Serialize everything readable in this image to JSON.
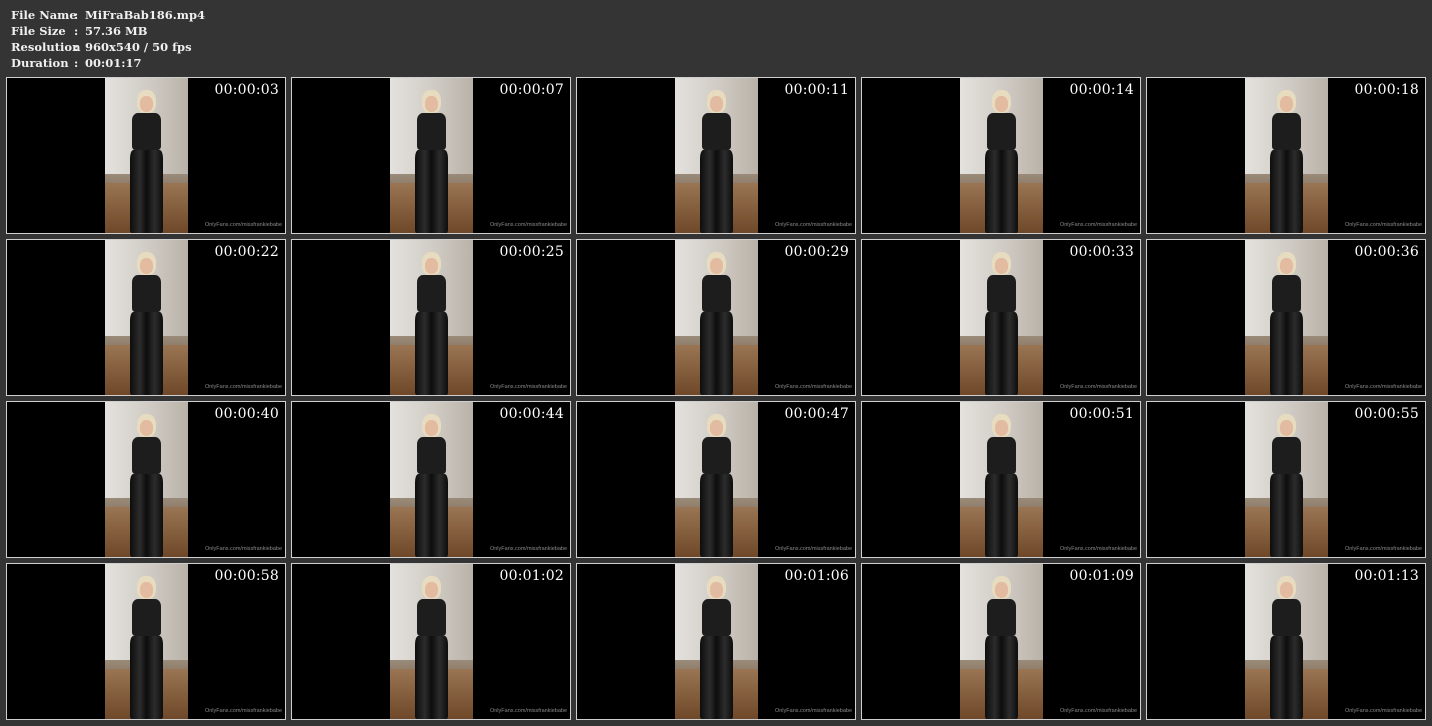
{
  "info": {
    "rows": [
      {
        "key": "File Name",
        "sep": ":",
        "value": "MiFraBab186.mp4"
      },
      {
        "key": "File Size",
        "sep": ":",
        "value": "57.36 MB"
      },
      {
        "key": "Resolution",
        "sep": ":",
        "value": "960x540 / 50 fps"
      },
      {
        "key": "Duration",
        "sep": ":",
        "value": "00:01:17"
      }
    ]
  },
  "watermark": "OnlyFans.com/missfrankiebabe",
  "thumbnails": [
    {
      "timestamp": "00:00:03"
    },
    {
      "timestamp": "00:00:07"
    },
    {
      "timestamp": "00:00:11"
    },
    {
      "timestamp": "00:00:14"
    },
    {
      "timestamp": "00:00:18"
    },
    {
      "timestamp": "00:00:22"
    },
    {
      "timestamp": "00:00:25"
    },
    {
      "timestamp": "00:00:29"
    },
    {
      "timestamp": "00:00:33"
    },
    {
      "timestamp": "00:00:36"
    },
    {
      "timestamp": "00:00:40"
    },
    {
      "timestamp": "00:00:44"
    },
    {
      "timestamp": "00:00:47"
    },
    {
      "timestamp": "00:00:51"
    },
    {
      "timestamp": "00:00:55"
    },
    {
      "timestamp": "00:00:58"
    },
    {
      "timestamp": "00:01:02"
    },
    {
      "timestamp": "00:01:06"
    },
    {
      "timestamp": "00:01:09"
    },
    {
      "timestamp": "00:01:13"
    }
  ]
}
